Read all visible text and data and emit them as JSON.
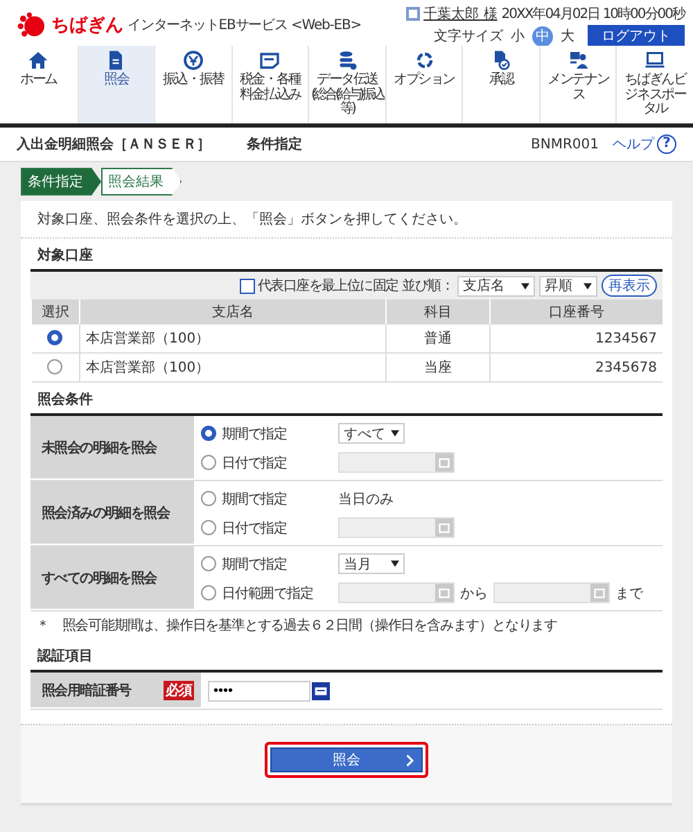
{
  "header": {
    "logo_text": "ちばぎん",
    "service_name": "インターネットEBサービス <Web-EB>",
    "user_name": "千葉太郎 様",
    "datetime": "20XX年04月02日 10時00分00秒",
    "font_size_label": "文字サイズ",
    "font_sizes": [
      {
        "label": "小",
        "selected": false
      },
      {
        "label": "中",
        "selected": true
      },
      {
        "label": "大",
        "selected": false
      }
    ],
    "logout": "ログアウト"
  },
  "nav": [
    {
      "label": "ホーム",
      "kind": "home",
      "selected": false
    },
    {
      "label": "照会",
      "kind": "document",
      "selected": true
    },
    {
      "label": "振込・振替",
      "kind": "coin",
      "selected": false
    },
    {
      "label": "税金・各種料金払込み",
      "kind": "card",
      "selected": false
    },
    {
      "label": "データ伝送",
      "sub": "(総合(給与)振込等)",
      "kind": "database",
      "selected": false
    },
    {
      "label": "オプション",
      "kind": "ring",
      "selected": false
    },
    {
      "label": "承認",
      "kind": "approve",
      "selected": false
    },
    {
      "label": "メンテナンス",
      "kind": "person",
      "selected": false
    },
    {
      "label": "ちばぎんビジネスポータル",
      "kind": "laptop",
      "selected": false
    }
  ],
  "page": {
    "title": "入出金明細照会［ＡＮＳＥＲ］",
    "subtitle": "条件指定",
    "screen_id": "BNMR001",
    "help": "ヘルプ",
    "help_mark": "?"
  },
  "steps": [
    {
      "label": "条件指定",
      "selected": true
    },
    {
      "label": "照会結果",
      "selected": false
    }
  ],
  "instruction": "対象口座、照会条件を選択の上、「照会」ボタンを押してください。",
  "accounts": {
    "title": "対象口座",
    "pin_top": {
      "label": "代表口座を最上位に固定",
      "checked": false
    },
    "sort_label": "並び順：",
    "sort_field": "支店名",
    "sort_order": "昇順",
    "refresh": "再表示",
    "columns": [
      "選択",
      "支店名",
      "科目",
      "口座番号"
    ],
    "rows": [
      {
        "selected": true,
        "branch": "本店営業部（100）",
        "type": "普通",
        "number": "1234567"
      },
      {
        "selected": false,
        "branch": "本店営業部（100）",
        "type": "当座",
        "number": "2345678"
      }
    ]
  },
  "conditions": {
    "title": "照会条件",
    "groups": [
      {
        "label": "未照会の明細を照会",
        "options": [
          {
            "label": "期間で指定",
            "selected": true,
            "kind": "select",
            "value": "すべて"
          },
          {
            "label": "日付で指定",
            "selected": false,
            "kind": "date"
          }
        ]
      },
      {
        "label": "照会済みの明細を照会",
        "options": [
          {
            "label": "期間で指定",
            "selected": false,
            "kind": "text",
            "value": "当日のみ"
          },
          {
            "label": "日付で指定",
            "selected": false,
            "kind": "date"
          }
        ]
      },
      {
        "label": "すべての明細を照会",
        "options": [
          {
            "label": "期間で指定",
            "selected": false,
            "kind": "select",
            "value": "当月"
          },
          {
            "label": "日付範囲で指定",
            "selected": false,
            "kind": "range",
            "from": "から",
            "to": "まで"
          }
        ]
      }
    ]
  },
  "note": "＊　照会可能期間は、操作日を基準とする過去６２日間（操作日を含みます）となります",
  "auth": {
    "title": "認証項目",
    "label": "照会用暗証番号",
    "required": "必須",
    "value": "••••"
  },
  "submit": "照会"
}
